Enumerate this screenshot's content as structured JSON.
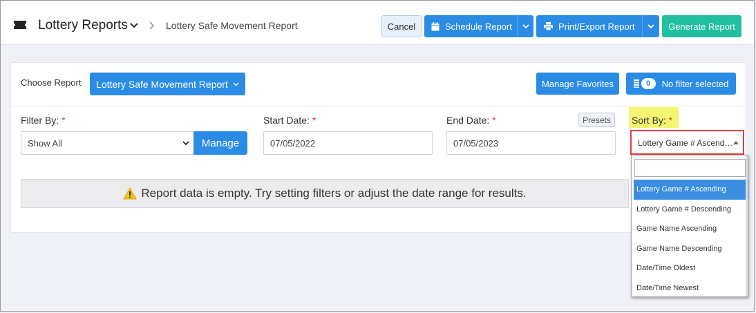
{
  "header": {
    "app_title": "Lottery Reports",
    "breadcrumb": "Lottery Safe Movement Report",
    "cancel_label": "Cancel",
    "schedule_label": "Schedule Report",
    "print_label": "Print/Export Report",
    "generate_label": "Generate Report"
  },
  "report": {
    "choose_label": "Choose Report",
    "selected_report": "Lottery Safe Movement Report",
    "manage_favorites_label": "Manage Favorites",
    "filter_count": "0",
    "filter_status": "No filter selected"
  },
  "filters": {
    "filter_by_label": "Filter By:",
    "filter_by_value": "Show All",
    "manage_label": "Manage",
    "start_date_label": "Start Date:",
    "start_date_value": "07/05/2022",
    "end_date_label": "End Date:",
    "end_date_value": "07/05/2023",
    "presets_label": "Presets",
    "sort_by_label": "Sort By:",
    "sort_by_value": "Lottery Game # Ascending",
    "required_mark": "*"
  },
  "empty_message": "Report data is empty. Try setting filters or adjust the date range for results.",
  "sort_options": [
    "Lottery Game # Ascending",
    "Lottery Game # Descending",
    "Game Name Ascending",
    "Game Name Descending",
    "Date/Time Oldest",
    "Date/Time Newest"
  ],
  "colors": {
    "primary": "#2b8ce6",
    "success": "#1fbf9f",
    "required": "#e03a3a",
    "highlight": "#f5f571"
  }
}
